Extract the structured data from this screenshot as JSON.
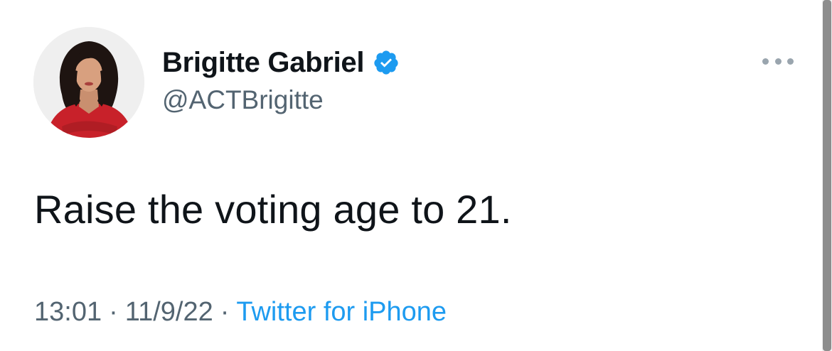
{
  "author": {
    "display_name": "Brigitte Gabriel",
    "handle": "@ACTBrigitte",
    "verified": true,
    "avatar_icon": "profile-photo"
  },
  "tweet": {
    "text": "Raise the voting age to 21."
  },
  "meta": {
    "time": "13:01",
    "separator": "·",
    "date": "11/9/22",
    "source": "Twitter for iPhone"
  },
  "colors": {
    "text_primary": "#0f1419",
    "text_secondary": "#536471",
    "link": "#1d9bf0",
    "verified_badge": "#1d9bf0"
  }
}
